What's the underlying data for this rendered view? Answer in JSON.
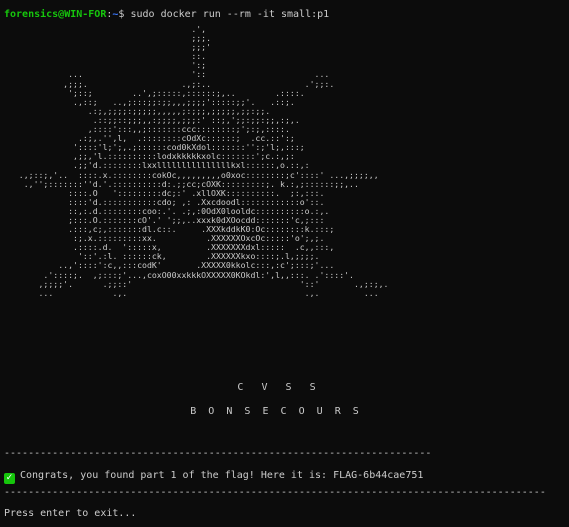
{
  "terminal": {
    "prompt": {
      "user_host": "forensics@WIN-FOR",
      "separator": ":",
      "path": "~",
      "symbol": "$ ",
      "command": "sudo docker run --rm -it small:p1"
    },
    "logo_art": "                                      .',\n                                      ;;;.\n                                      ;;;'\n                                      ::.\n                                      ':;\n             ...                      '::                      ...\n            ,;;;.                   .,;:..                   .';;:.\n             ';::;        ..',;:::::,::::::;,..        .::::.\n              .,::;   ..,;:::;;:;;,,,;;;;':::::;;'.   .::;.\n                 .:;,;;;;:;;;;;,,,,,;:;;;,;;;;;,;;:;;.\n                  .::;;::;;;,,:;;;;,;;;:' ::;,';;:;;:;;,:;,.\n                 ,::::':::,,;:::::::ccc::::::::;';:;,::::.\n               .:;,.'',l,  .::::::::cOdXc::::::;  .cc.::':;\n              '::::'l;';,.;::::::cod0kXdol:::::::'':;'l;,:::;\n              ,;;,'l.::::::::::lodxkkkkkxolc:::::::';c.:,;:\n              .;;'d.::::::::lxxlllllllllllllllkxl::::::,o.::,:\n   .,;::;,'..  ::::.x.::::::::cokOc,,,,,,,,,o0xoc::::::::;c'::::' ...,;;;;,,\n    .,'';:::::::''d.'.::::::::::d:.;;cc;cOXK:::::::::;. k.:,;::::::;;,..\n             ::::.O   ':::::::::dc;:' .xllOXK::::::::::.  ;:,:::.\n             ::::'d.:::::::::::cdo; ,: .Xxcdoodl::::::::::::o'::.\n             ::,:.d.::::::::coo:.'. .;,:0OdX0looldc::::::::::o.:,.\n             ;:::.O.:::::::cO'.' ';;,..xxxk0dXOocdd:::::::'c,;:::\n             .:::,c;,:::::::dl.c::.     .XXXkddkK0:Oc::::::::k.:::;\n              :;.x.:::::::::xx.          .XXXXXXOxcOc:::::'o';,;.\n              .::::.d.  ':::::x,         .XXXXXXXdxl:::::  .c,,:::,\n               '::'.:l. ::::::ck,        .XXXXXXkxo::::;.l,;;;;.\n           ..,'::::':c,,:::codK'       .XXXXX0kkolc:::,:c';:::;'...\n        .'::::;.  ,;:::;'...,coxO00xxkkkOXXXXX0KOkdl:',l,,:::. .'::::'.\n       ,;;;;'.      .;;::'                                  '::'       .,;:;,.\n       ...            .,.                                    .,.         ...",
    "cvss_text": "C   V   S   S",
    "org_text": "B  O  N  S  E  C  O  U  R  S",
    "separator_top": "----------------------------------------------------------------------------------------------------------",
    "separator_bottom": "--------------------------------------------------------------------------------------------------------------------------",
    "check_icon_symbol": "✓",
    "congrats_message": "Congrats, you found part 1 of the flag! Here it is: FLAG-6b44cae751",
    "exit_prompt": "Press enter to exit..."
  },
  "colors": {
    "background": "#0c0c0c",
    "text": "#cccccc",
    "prompt_user": "#16c60c",
    "prompt_path": "#3b78ff",
    "check_icon": "#16c60c"
  }
}
